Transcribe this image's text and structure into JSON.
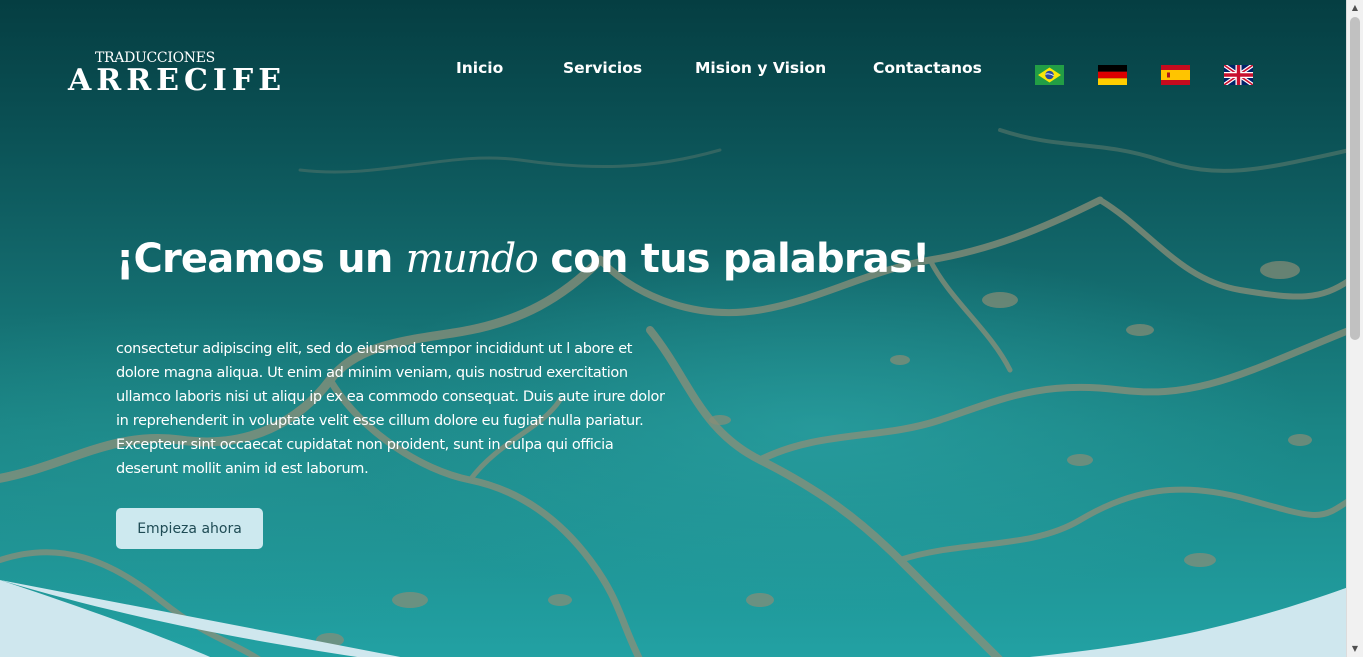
{
  "brand": {
    "small": "TRADUCCIONES",
    "big": "ARRECIFE"
  },
  "nav": {
    "items": [
      "Inicio",
      "Servicios",
      "Mision y Vision",
      "Contactanos"
    ]
  },
  "languages": [
    {
      "icon": "brazil-flag-icon"
    },
    {
      "icon": "germany-flag-icon"
    },
    {
      "icon": "spain-flag-icon"
    },
    {
      "icon": "uk-flag-icon"
    }
  ],
  "hero": {
    "title_before": "¡Creamos un ",
    "title_em": "mundo",
    "title_after": " con tus palabras!",
    "body": "consectetur adipiscing elit, sed do eiusmod tempor incididunt ut l abore et dolore magna aliqua. Ut enim ad minim veniam, quis nostrud exercitation ullamco laboris nisi ut aliqu ip ex ea commodo consequat. Duis aute irure dolor in reprehenderit in voluptate velit esse cillum dolore eu fugiat nulla pariatur. Excepteur sint occaecat cupidatat non proident, sunt in culpa qui officia deserunt mollit anim id est laborum.",
    "cta": "Empieza ahora"
  },
  "colors": {
    "sea_dark": "#053e42",
    "sea_light": "#22a1a3",
    "reef": "#8a8e78",
    "button_bg": "#cde9ef",
    "wave": "#cfe7ee"
  }
}
